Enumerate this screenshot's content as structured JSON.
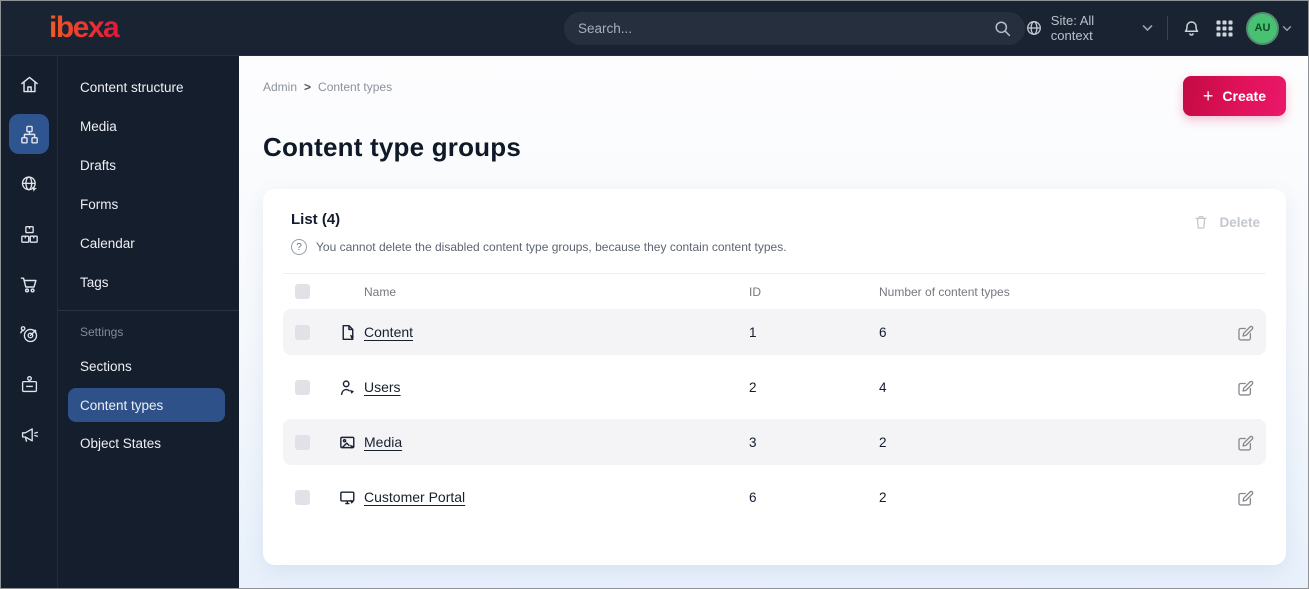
{
  "topbar": {
    "logo": "ibexa",
    "search": {
      "placeholder": "Search..."
    },
    "site_selector": {
      "label": "Site: All context"
    },
    "avatar": {
      "initials": "AU"
    },
    "icon_names": [
      "search-icon",
      "globe-icon",
      "chevron-down-icon",
      "bell-icon",
      "app-grid-icon",
      "avatar-chevron-down-icon"
    ]
  },
  "sidebar": {
    "rail_icons": [
      {
        "name": "home-icon",
        "selected": false
      },
      {
        "name": "content-tree-icon",
        "selected": true
      },
      {
        "name": "site-globe-icon",
        "selected": false
      },
      {
        "name": "product-catalog-icon",
        "selected": false
      },
      {
        "name": "commerce-cart-icon",
        "selected": false
      },
      {
        "name": "marketing-target-icon",
        "selected": false
      },
      {
        "name": "admin-badge-icon",
        "selected": false
      },
      {
        "name": "announcements-megaphone-icon",
        "selected": false
      }
    ],
    "menu": [
      {
        "label": "Content structure"
      },
      {
        "label": "Media"
      },
      {
        "label": "Drafts"
      },
      {
        "label": "Forms"
      },
      {
        "label": "Calendar"
      },
      {
        "label": "Tags"
      }
    ],
    "settings_header": "Settings",
    "settings_menu": [
      {
        "label": "Sections",
        "selected": false
      },
      {
        "label": "Content types",
        "selected": true
      },
      {
        "label": "Object States",
        "selected": false
      }
    ]
  },
  "breadcrumb": {
    "items": [
      "Admin",
      "Content types"
    ],
    "separator": ">"
  },
  "page": {
    "title": "Content type groups",
    "create_button": "Create",
    "create_plus": "+"
  },
  "list_card": {
    "title": "List (4)",
    "hint": "You cannot delete the disabled content type groups, because they contain content types.",
    "hint_icon": "?",
    "delete_button": "Delete",
    "columns": {
      "name": "Name",
      "id": "ID",
      "count": "Number of content types"
    },
    "rows": [
      {
        "icon": "content-file-icon",
        "name": "Content",
        "id": "1",
        "count": "6"
      },
      {
        "icon": "users-person-icon",
        "name": "Users",
        "id": "2",
        "count": "4"
      },
      {
        "icon": "media-image-icon",
        "name": "Media",
        "id": "3",
        "count": "2"
      },
      {
        "icon": "customer-portal-monitor-icon",
        "name": "Customer Portal",
        "id": "6",
        "count": "2"
      }
    ]
  },
  "colors": {
    "topbar_bg": "#1a2331",
    "sidebar_bg": "#151e2c",
    "selected_blue": "#2f5590",
    "brand_gradient_start": "#c30b43",
    "brand_gradient_end": "#e9186a",
    "avatar_green": "#49c173",
    "row_shaded": "#f4f4f6",
    "main_bg_bottom": "#e7f0fb"
  }
}
